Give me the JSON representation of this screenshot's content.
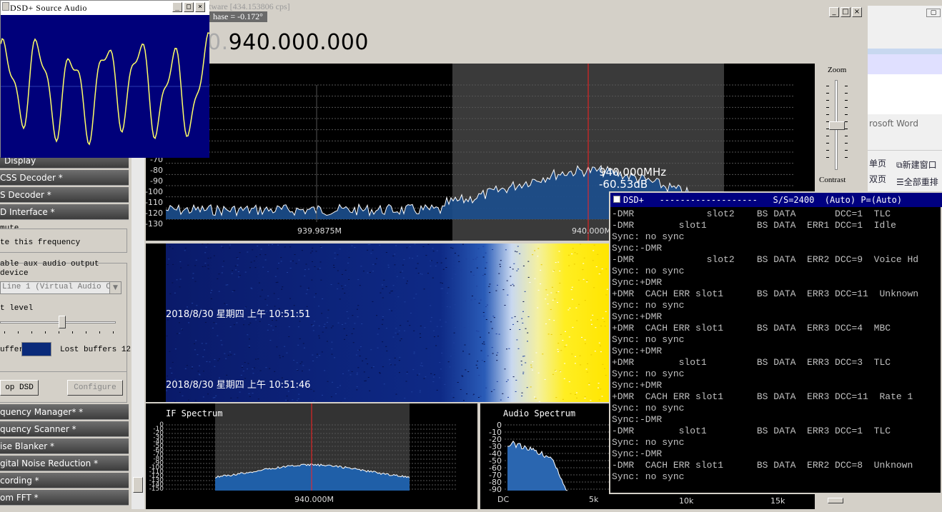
{
  "source_audio": {
    "title": "DSD+ Source Audio"
  },
  "main": {
    "title_fragment": "tware   [434.153806 cps]",
    "phase_label": "hase = -0.172°",
    "frequency_dim": "0.",
    "frequency": "940.000.000"
  },
  "fft": {
    "db_ticks": [
      "-70",
      "-80",
      "-90",
      "-100",
      "-110",
      "-120",
      "-130"
    ],
    "x_ticks": [
      "939.9875M",
      "940.000M"
    ],
    "cursor_freq": "940.000MHz",
    "cursor_db": "-60.53dB"
  },
  "zoom": {
    "zoom_label": "Zoom",
    "contrast_label": "Contrast"
  },
  "waterfall": {
    "timestamp_1": "2018/8/30 星期四 上午 10:51:51",
    "timestamp_2": "2018/8/30 星期四 上午 10:51:46"
  },
  "if_spectrum": {
    "title": "IF Spectrum",
    "y_ticks": [
      "0",
      "-10",
      "-20",
      "-30",
      "-40",
      "-50",
      "-60",
      "-70",
      "-80",
      "-90",
      "-100",
      "-110",
      "-120",
      "-130",
      "-140",
      "-150"
    ],
    "x_tick": "940.000M"
  },
  "audio_spectrum": {
    "title": "Audio Spectrum",
    "y_ticks": [
      "0",
      "-10",
      "-20",
      "-30",
      "-40",
      "-50",
      "-60",
      "-70",
      "-80",
      "-90"
    ],
    "x_ticks": [
      "DC",
      "5k",
      "10k",
      "15k"
    ]
  },
  "sidebar": {
    "headers": [
      "Display",
      "CSS Decoder *",
      "S Decoder *",
      "D Interface *"
    ],
    "mute_group": "mute",
    "mute_freq": "te this frequency",
    "aux_line1": "able aux audio output",
    "aux_line2": " device",
    "device_select": "Line 1 (Virtual Audio Cab",
    "level_label": "t level",
    "buffer_label": "uffer",
    "lost_buffers": "Lost buffers 12",
    "stop_button": "op DSD",
    "configure_button": "Configure",
    "bottom_headers": [
      "quency Manager* *",
      "quency Scanner *",
      "ise Blanker *",
      "gital Noise Reduction *",
      "cording *",
      "om FFT *"
    ]
  },
  "right_window": {
    "word_label": "rosoft Word",
    "btn1": "单页",
    "btn2": "新建窗口",
    "btn3": "双页",
    "btn4": "全部重排"
  },
  "console": {
    "title": "DSD+   -------------------   S/S=2400  (Auto) P=(Auto)",
    "lines": [
      "-DMR             slot2    BS DATA       DCC=1  TLC",
      "-DMR        slot1         BS DATA  ERR1 DCC=1  Idle",
      "Sync: no sync",
      "Sync:-DMR",
      "-DMR             slot2    BS DATA  ERR2 DCC=9  Voice Hd",
      "Sync: no sync",
      "Sync:+DMR",
      "+DMR  CACH ERR slot1      BS DATA  ERR3 DCC=11  Unknown",
      "Sync: no sync",
      "Sync:+DMR",
      "+DMR  CACH ERR slot1      BS DATA  ERR3 DCC=4  MBC",
      "Sync: no sync",
      "Sync:+DMR",
      "+DMR        slot1         BS DATA  ERR3 DCC=3  TLC",
      "Sync: no sync",
      "Sync:+DMR",
      "+DMR  CACH ERR slot1      BS DATA  ERR3 DCC=11  Rate 1",
      "Sync: no sync",
      "Sync:-DMR",
      "-DMR        slot1         BS DATA  ERR3 DCC=1  TLC",
      "Sync: no sync",
      "Sync:-DMR",
      "-DMR  CACH ERR slot1      BS DATA  ERR2 DCC=8  Unknown",
      "Sync: no sync"
    ]
  },
  "colors": {
    "console_bg": "#000000",
    "console_title_bg": "#000080",
    "waveform_bg": "#00007a",
    "waveform": "#ffff66",
    "spectrum_fill": "#1f5fa8",
    "marker": "#ff2020"
  }
}
